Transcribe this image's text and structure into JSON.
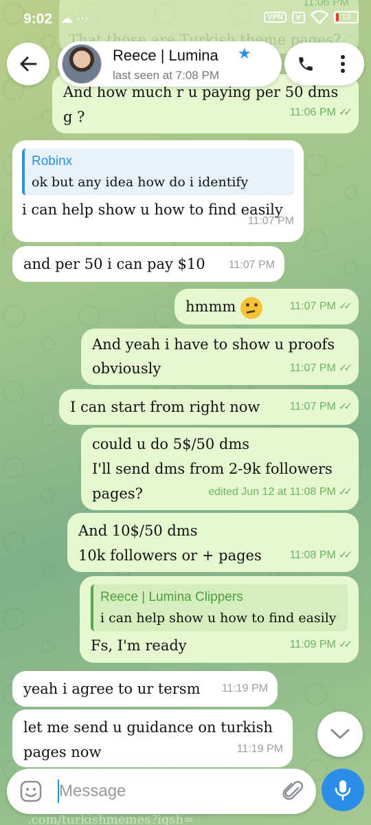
{
  "status_bar": {
    "time": "9:02",
    "left_icons": "☁ ⋯",
    "vpn": "VPN",
    "battery_level": "13"
  },
  "header": {
    "name": "Reece | Lumina",
    "status": "last seen at 7:08 PM"
  },
  "background_partial": {
    "top_text": "That those are Turkish theme pages?",
    "top_time": "11:06 PM",
    "bottom_text": ".com/turkishmemes?igsh="
  },
  "messages": [
    {
      "dir": "out",
      "text": "And how much r u paying per 50 dms g ?",
      "time": "11:06 PM"
    },
    {
      "dir": "in",
      "reply_name": "Robinx",
      "reply_text": "ok but any idea how do i identify",
      "text": "i can help show u how to find easily",
      "time": "11:07 PM"
    },
    {
      "dir": "in",
      "text": "and per 50 i can pay $10",
      "time": "11:07 PM"
    },
    {
      "dir": "out",
      "text": "hmmm",
      "time": "11:07 PM"
    },
    {
      "dir": "out",
      "text": "And yeah i have to show u proofs obviously",
      "time": "11:07 PM"
    },
    {
      "dir": "out",
      "text": "I can start from right now",
      "time": "11:07 PM"
    },
    {
      "dir": "out",
      "text": "could u do 5$/50 dms\nI'll send dms from 2-9k followers pages?",
      "time": "edited Jun 12 at 11:08 PM"
    },
    {
      "dir": "out",
      "text": "And 10$/50 dms\n10k followers or + pages",
      "time": "11:08 PM"
    },
    {
      "dir": "out",
      "reply_name": "Reece | Lumina Clippers",
      "reply_text": "i can help show u how to find easily",
      "text": "Fs, I'm ready",
      "time": "11:09 PM"
    },
    {
      "dir": "in",
      "text": "yeah i agree to ur tersm",
      "time": "11:19 PM"
    },
    {
      "dir": "in",
      "text": "let me send u guidance on turkish pages now",
      "time": "11:19 PM"
    }
  ],
  "composer": {
    "placeholder": "Message"
  },
  "colors": {
    "accent": "#2b8ee6",
    "outgoing_bubble": "#e6f8d0",
    "incoming_bubble": "#ffffff",
    "tick_green": "#6db35f"
  }
}
